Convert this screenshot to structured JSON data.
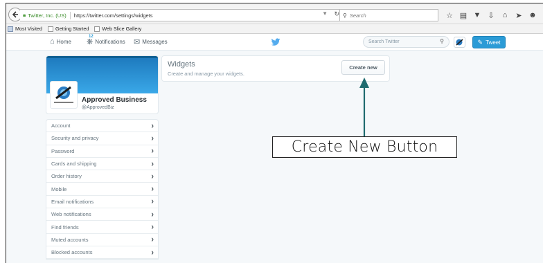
{
  "browser": {
    "identity": "Twitter, Inc. (US)",
    "url": "https://twitter.com/settings/widgets",
    "search_placeholder": "Search",
    "bookmarks": [
      {
        "label": "Most Visited",
        "icon": "bookmarks-folder-icon"
      },
      {
        "label": "Getting Started",
        "icon": "page-icon"
      },
      {
        "label": "Web Slice Gallery",
        "icon": "page-icon"
      }
    ],
    "toolbar_icons": [
      "star-icon",
      "reading-list-icon",
      "pocket-icon",
      "download-icon",
      "home-icon",
      "send-icon",
      "hello-icon",
      "menu-icon"
    ]
  },
  "twitter": {
    "nav": {
      "home": "Home",
      "notifications": "Notifications",
      "notification_count": "12",
      "messages": "Messages"
    },
    "search_placeholder": "Search Twitter",
    "tweet_button": "Tweet",
    "brand_color": "#55acee"
  },
  "profile": {
    "name": "Approved Business",
    "handle": "@ApprovedBiz"
  },
  "settings_menu": [
    "Account",
    "Security and privacy",
    "Password",
    "Cards and shipping",
    "Order history",
    "Mobile",
    "Email notifications",
    "Web notifications",
    "Find friends",
    "Muted accounts",
    "Blocked accounts"
  ],
  "widgets": {
    "title": "Widgets",
    "subtitle": "Create and manage your widgets.",
    "create_button": "Create new"
  },
  "annotation": {
    "label": "Create New Button",
    "arrow_color": "#1f6b6f"
  }
}
